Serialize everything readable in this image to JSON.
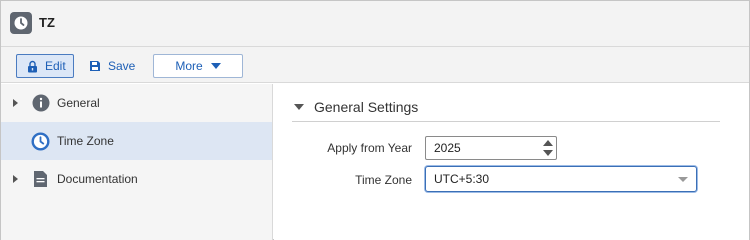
{
  "window": {
    "title": "TZ",
    "icon": "clock-icon"
  },
  "toolbar": {
    "edit_label": "Edit",
    "save_label": "Save",
    "more_label": "More"
  },
  "sidebar": {
    "items": [
      {
        "label": "General",
        "icon": "info-icon",
        "expandable": true,
        "active": false
      },
      {
        "label": "Time Zone",
        "icon": "clock-icon",
        "expandable": false,
        "active": true
      },
      {
        "label": "Documentation",
        "icon": "document-icon",
        "expandable": true,
        "active": false
      }
    ]
  },
  "main": {
    "section_title": "General Settings",
    "fields": {
      "apply_from_year": {
        "label": "Apply from Year",
        "value": "2025"
      },
      "time_zone": {
        "label": "Time Zone",
        "value": "UTC+5:30"
      }
    }
  },
  "colors": {
    "accent": "#1d5fb6",
    "selected_bg": "#dde6f3",
    "toolbar_bg": "#f3f3f3"
  }
}
